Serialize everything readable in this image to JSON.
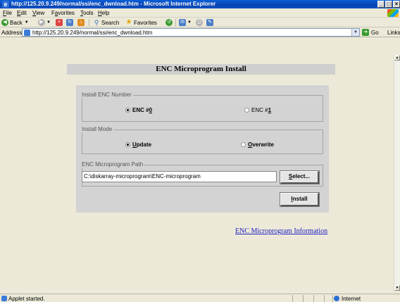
{
  "window": {
    "title": "http://125.20.9.249/normal/ssi/enc_dwnload.htm - Microsoft Internet Explorer",
    "controls": [
      "_",
      "×"
    ]
  },
  "menubar": {
    "items": [
      {
        "pre": "",
        "u": "F",
        "post": "ile"
      },
      {
        "pre": "",
        "u": "E",
        "post": "dit"
      },
      {
        "pre": "",
        "u": "V",
        "post": "iew"
      },
      {
        "pre": "F",
        "u": "a",
        "post": "vorites"
      },
      {
        "pre": "",
        "u": "T",
        "post": "ools"
      },
      {
        "pre": "",
        "u": "H",
        "post": "elp"
      }
    ]
  },
  "toolbar": {
    "back_label": "Back",
    "search_label": "Search",
    "favorites_label": "Favorites"
  },
  "address": {
    "label": "Address",
    "url": "http://125.20.9.249/normal/ssi/enc_dwnload.htm",
    "go_label": "Go",
    "links_label": "Links"
  },
  "page": {
    "heading": "ENC Microprogram Install",
    "install_number": {
      "title": "Install ENC Number",
      "options": [
        {
          "pre": "ENC #",
          "u": "0",
          "selected": true
        },
        {
          "pre": "ENC #",
          "u": "1",
          "selected": false
        }
      ]
    },
    "install_mode": {
      "title": "Install Mode",
      "options": [
        {
          "pre": "",
          "u": "U",
          "post": "pdate",
          "selected": true
        },
        {
          "pre": "",
          "u": "O",
          "post": "verwrite",
          "selected": false
        }
      ]
    },
    "path": {
      "title": "ENC Microprogram Path",
      "value": "C:\\diskarray-microprogram\\ENC-microprogram",
      "select_pre": "",
      "select_u": "S",
      "select_post": "elect..."
    },
    "install_pre": "",
    "install_u": "I",
    "install_post": "nstall",
    "info_link": "ENC Microprogram Information"
  },
  "status": {
    "text": "Applet started.",
    "zone": "Internet"
  }
}
